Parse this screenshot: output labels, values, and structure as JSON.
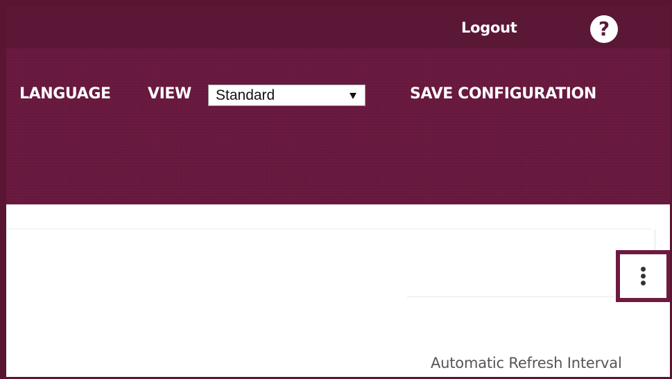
{
  "header": {
    "logout_label": "Logout",
    "help_icon": "question-mark-icon",
    "help_symbol": "?"
  },
  "nav": {
    "language_label": "LANGUAGE",
    "view_label": "VIEW",
    "view_select": {
      "selected": "Standard"
    },
    "save_label": "SAVE CONFIGURATION"
  },
  "content": {
    "menu_icon": "more-vertical-icon",
    "refresh_label": "Automatic Refresh Interval"
  },
  "colors": {
    "brand": "#6b1a40",
    "top_bar": "#5b1836",
    "highlight_border": "#6d1a41"
  }
}
